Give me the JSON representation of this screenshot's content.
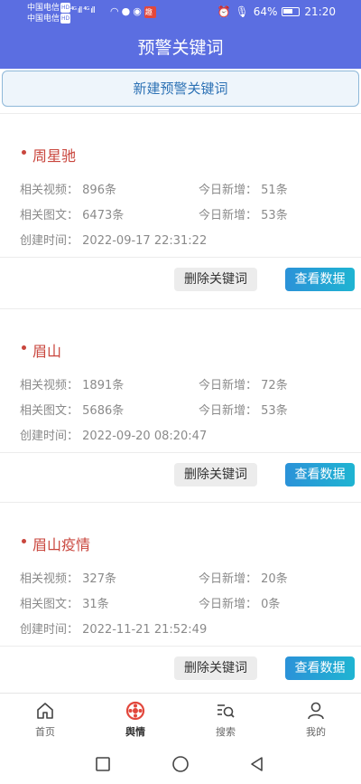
{
  "status_bar": {
    "carrier1": "中国电信",
    "carrier2": "中国电信",
    "hd_label": "HD",
    "signal": "⁴ᴳ ıll ⁴ᴳ ıll",
    "badge": "趣",
    "battery": "64%",
    "time": "21:20"
  },
  "header": {
    "title": "预警关键词"
  },
  "new_keyword_button": "新建预警关键词",
  "cards": [
    {
      "keyword": "周星驰",
      "video_label": "相关视频：",
      "video_value": "896条",
      "video_new_label": "今日新增：",
      "video_new_value": "51条",
      "image_label": "相关图文：",
      "image_value": "6473条",
      "image_new_label": "今日新增：",
      "image_new_value": "53条",
      "created_label": "创建时间：",
      "created_value": "2022-09-17 22:31:22",
      "delete_label": "删除关键词",
      "view_label": "查看数据"
    },
    {
      "keyword": "眉山",
      "video_label": "相关视频：",
      "video_value": "1891条",
      "video_new_label": "今日新增：",
      "video_new_value": "72条",
      "image_label": "相关图文：",
      "image_value": "5686条",
      "image_new_label": "今日新增：",
      "image_new_value": "53条",
      "created_label": "创建时间：",
      "created_value": "2022-09-20 08:20:47",
      "delete_label": "删除关键词",
      "view_label": "查看数据"
    },
    {
      "keyword": "眉山疫情",
      "video_label": "相关视频：",
      "video_value": "327条",
      "video_new_label": "今日新增：",
      "video_new_value": "20条",
      "image_label": "相关图文：",
      "image_value": "31条",
      "image_new_label": "今日新增：",
      "image_new_value": "0条",
      "created_label": "创建时间：",
      "created_value": "2022-11-21 21:52:49",
      "delete_label": "删除关键词",
      "view_label": "查看数据"
    }
  ],
  "tabs": [
    {
      "label": "首页",
      "icon": "home-icon"
    },
    {
      "label": "舆情",
      "icon": "sentiment-icon",
      "active": true
    },
    {
      "label": "搜索",
      "icon": "search-icon"
    },
    {
      "label": "我的",
      "icon": "user-icon"
    }
  ],
  "colors": {
    "header": "#5b6ee1",
    "keyword": "#c9463d",
    "accent": "#2b92d8",
    "tab_active": "#e2473c"
  }
}
